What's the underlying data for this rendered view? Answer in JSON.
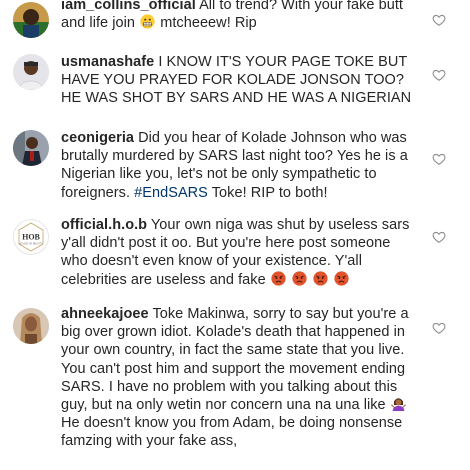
{
  "comments": [
    {
      "username": "iam_collins_official",
      "text_before": "All to trend? With your fake butt and life join",
      "text_after": " mtcheeew! Rip",
      "avatar_icon": "profile-photo"
    },
    {
      "username": "usmanashafe",
      "text": "I KNOW IT'S YOUR PAGE TOKE BUT HAVE YOU PRAYED FOR KOLADE JONSON TOO? HE WAS SHOT BY SARS AND HE WAS A NIGERIAN",
      "avatar_icon": "profile-photo"
    },
    {
      "username": "ceonigeria",
      "text": "Did you hear of Kolade Johnson who was brutally murdered by SARS last night too? Yes he is a Nigerian like you, let's not be only sympathetic to foreigners.",
      "hashtag": "#EndSARS",
      "text_end": "Toke! RIP to both!",
      "avatar_icon": "profile-photo"
    },
    {
      "username": "official.h.o.b",
      "text": "Your own niga was shut by useless sars y'all didn't post it oo. But you're here post someone who doesn't even know of your existence. Y'all celebrities are useless and fake",
      "avatar_text": "HOB",
      "avatar_subtext": "HOUSE OF BEAUTY",
      "angry_emoji_count": 4
    },
    {
      "username": "ahneekajoee",
      "text": "Toke Makinwa, sorry to say but you're a big over grown idiot. Kolade's death that happened in your own country, in fact the same state that you live. You can't post him and support the movement ending SARS. I have no problem with you talking about this guy, but na only wetin nor concern una na una like",
      "text_after": " He doesn't know you from Adam, be doing nonsense famzing with your fake ass,",
      "avatar_icon": "profile-photo"
    }
  ],
  "icons": {
    "like": "heart-outline-icon",
    "grimace": "grimacing-face-emoji",
    "shrug": "woman-shrugging-emoji",
    "angry": "angry-face-emoji"
  },
  "colors": {
    "text": "#262626",
    "hashtag": "#003569",
    "heart": "#8e8e8e"
  }
}
